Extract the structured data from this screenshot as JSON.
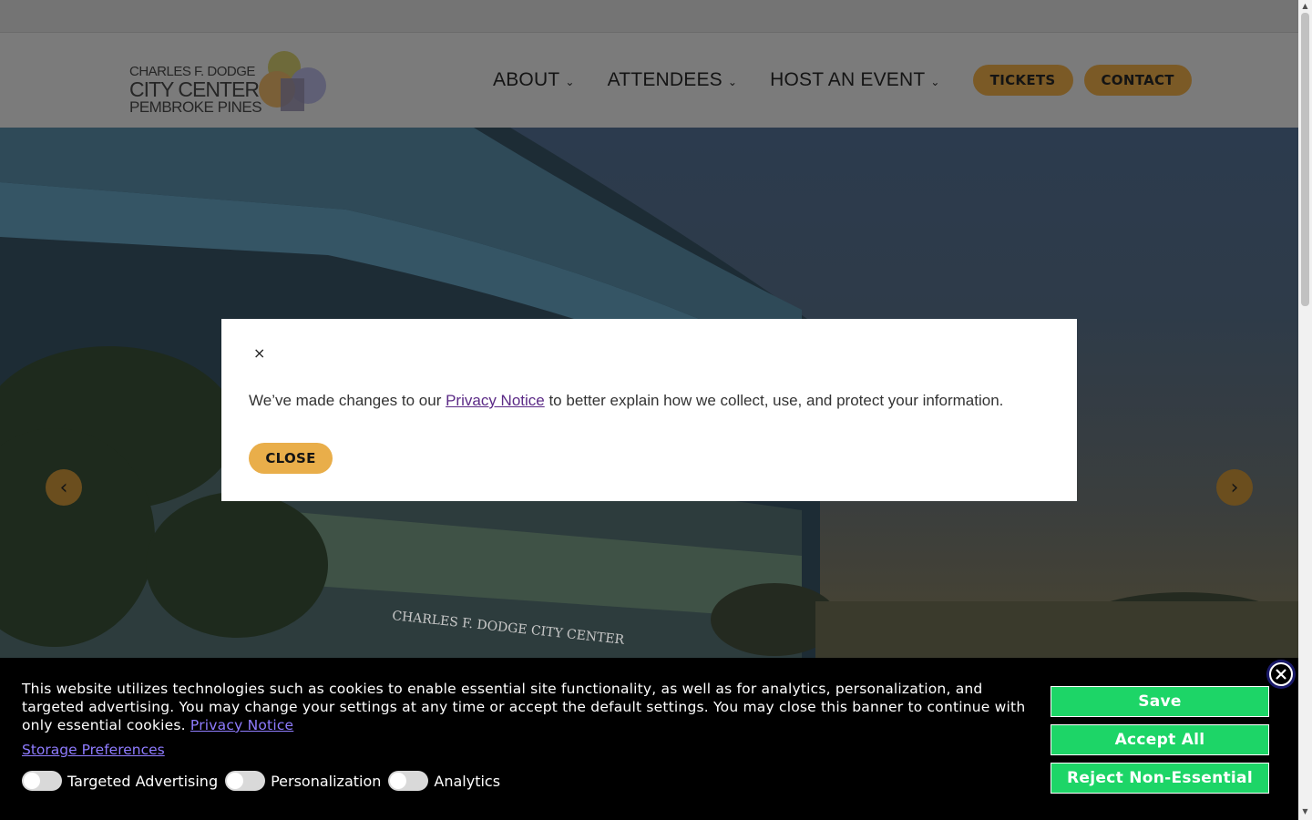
{
  "logo": {
    "line1": "CHARLES F. DODGE",
    "line2": "CITY CENTER",
    "line3": "PEMBROKE PINES",
    "icon": "logo-mark-icon"
  },
  "nav": {
    "items": [
      {
        "label": "ABOUT",
        "chev": "⌄"
      },
      {
        "label": "ATTENDEES",
        "chev": "⌄"
      },
      {
        "label": "HOST AN EVENT",
        "chev": "⌄"
      }
    ],
    "tickets": "TICKETS",
    "contact": "CONTACT"
  },
  "hero": {
    "building_sign": "CHARLES F. DODGE CITY CENTER",
    "prev_icon": "‹",
    "next_icon": "›"
  },
  "modal": {
    "close_x": "×",
    "text_before": "We’ve made changes to our ",
    "link": "Privacy Notice",
    "text_after": " to better explain how we collect, use, and protect your information.",
    "close_button": "CLOSE"
  },
  "banner": {
    "text": "This website utilizes technologies such as cookies to enable essential site functionality, as well as for analytics, personalization, and targeted advertising. You may change your settings at any time or accept the default settings. You may close this banner to continue with only essential cookies. ",
    "privacy_link": "Privacy Notice",
    "storage_link": "Storage Preferences",
    "toggles": [
      {
        "label": "Targeted Advertising",
        "on": false
      },
      {
        "label": "Personalization",
        "on": false
      },
      {
        "label": "Analytics",
        "on": false
      }
    ],
    "buttons": {
      "save": "Save",
      "accept": "Accept All",
      "reject": "Reject Non-Essential"
    }
  },
  "colors": {
    "accent_gold": "#e9ae4a",
    "banner_button_green": "#1dd567",
    "link_purple": "#5b2a86"
  }
}
